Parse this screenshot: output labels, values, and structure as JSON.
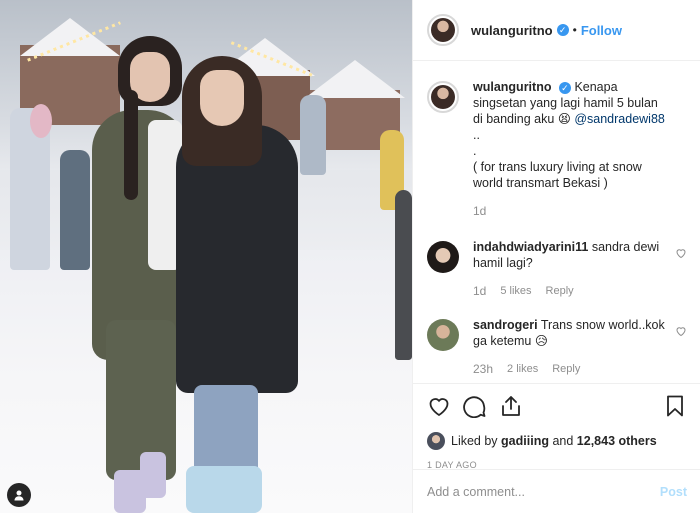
{
  "post": {
    "username": "wulanguritno",
    "follow_label": "Follow",
    "separator": "•",
    "caption": "Kenapa singsetan yang lagi hamil 5 bulan di banding aku",
    "caption_emoji": "😫",
    "mention": "@sandradewi88",
    "caption_tail": "..",
    "caption_dot": ".",
    "caption_note": "( for trans luxury living at snow world transmart Bekasi )",
    "caption_time": "1d"
  },
  "comments": [
    {
      "username": "indahdwiadyarini11",
      "text": "sandra dewi hamil lagi?",
      "time": "1d",
      "likes": "5 likes",
      "reply_label": "Reply"
    },
    {
      "username": "sandrogeri",
      "text": "Trans snow world..kok ga ketemu",
      "emoji": "😥",
      "time": "23h",
      "likes": "2 likes",
      "reply_label": "Reply"
    }
  ],
  "likes": {
    "prefix": "Liked by",
    "user": "gadiiing",
    "and": "and",
    "others": "12,843 others"
  },
  "date_label": "1 DAY AGO",
  "add_comment": {
    "placeholder": "Add a comment...",
    "post_label": "Post"
  },
  "icons": {
    "heart": "heart-icon",
    "comment": "comment-icon",
    "share": "share-icon",
    "save": "bookmark-icon",
    "user_tag": "user-tag-icon",
    "verified": "verified-badge-icon"
  },
  "colors": {
    "link_blue": "#3897f0",
    "verified_blue": "#3897f0",
    "muted": "#8e8e8e",
    "post_disabled": "#b2dffc"
  }
}
